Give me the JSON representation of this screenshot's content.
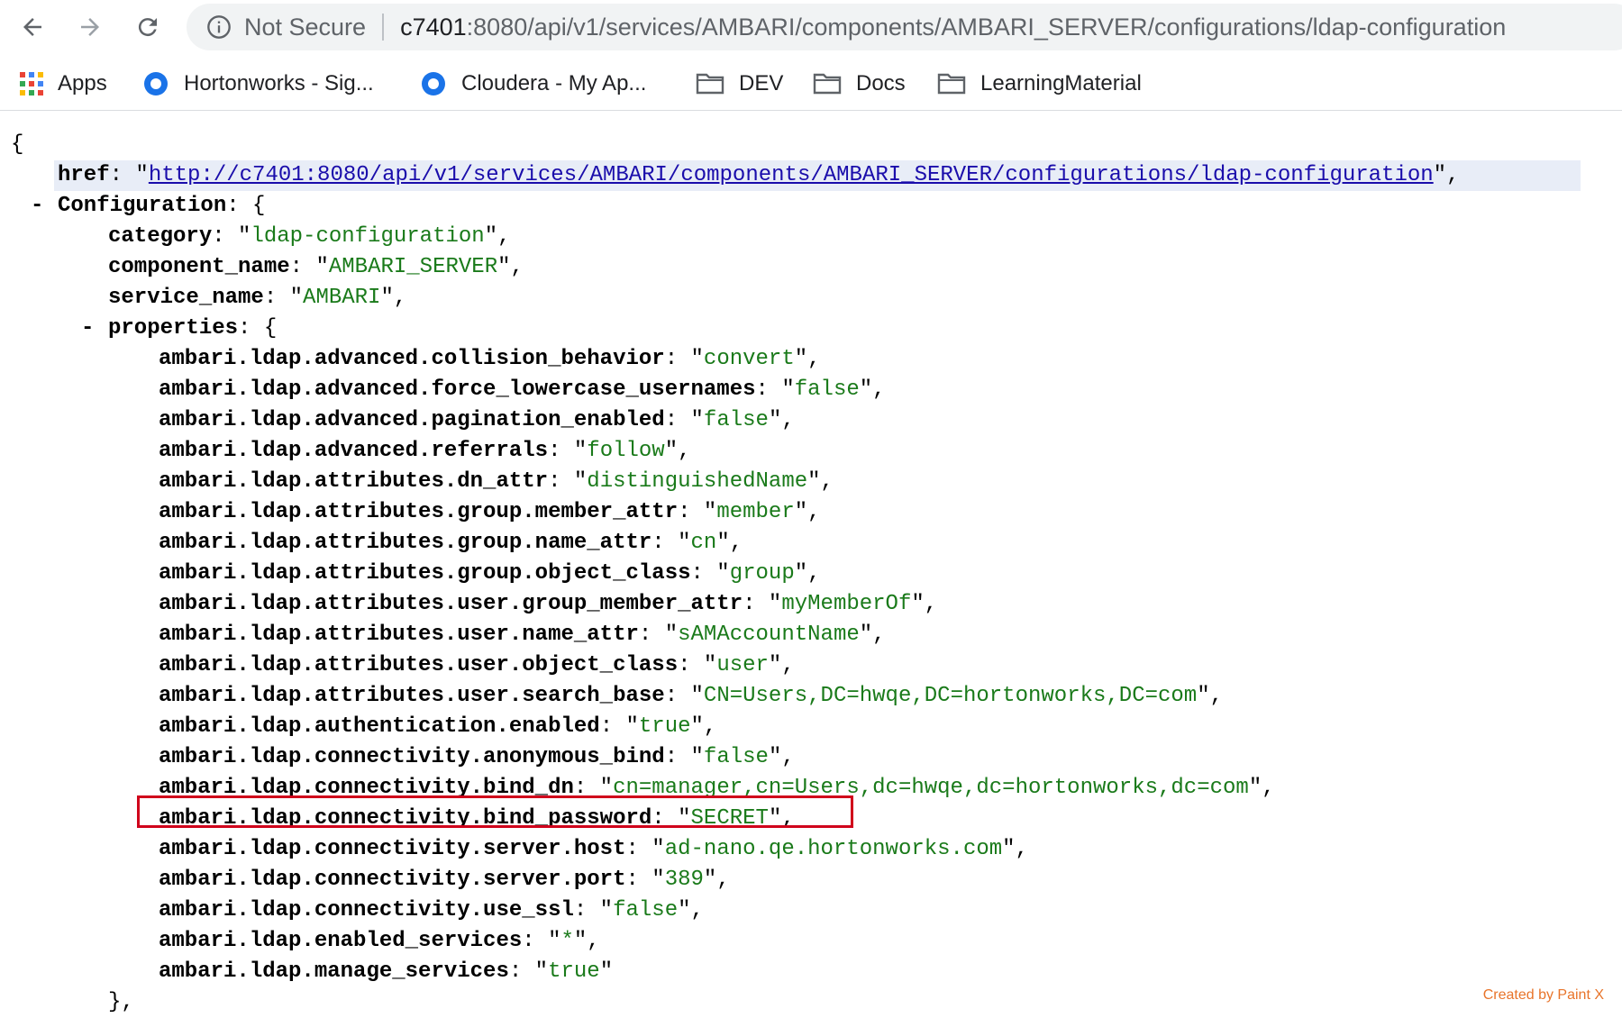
{
  "browser": {
    "security_label": "Not Secure",
    "url_host": "c7401",
    "url_rest": ":8080/api/v1/services/AMBARI/components/AMBARI_SERVER/configurations/ldap-configuration"
  },
  "bookmarks": [
    {
      "label": "Apps",
      "icon": "apps-grid-icon"
    },
    {
      "label": "Hortonworks - Sig...",
      "icon": "hortonworks-logo-icon"
    },
    {
      "label": "Cloudera - My Ap...",
      "icon": "cloudera-logo-icon"
    },
    {
      "label": "DEV",
      "icon": "folder-icon"
    },
    {
      "label": "Docs",
      "icon": "folder-icon"
    },
    {
      "label": "LearningMaterial",
      "icon": "folder-icon"
    }
  ],
  "json": {
    "open_brace": "{",
    "href_key": "href",
    "href_value": "http://c7401:8080/api/v1/services/AMBARI/components/AMBARI_SERVER/configurations/ldap-configuration",
    "configuration_key": "Configuration",
    "category_key": "category",
    "category_value": "ldap-configuration",
    "component_key": "component_name",
    "component_value": "AMBARI_SERVER",
    "service_key": "service_name",
    "service_value": "AMBARI",
    "properties_key": "properties",
    "properties": [
      {
        "key": "ambari.ldap.advanced.collision_behavior",
        "value": "convert"
      },
      {
        "key": "ambari.ldap.advanced.force_lowercase_usernames",
        "value": "false"
      },
      {
        "key": "ambari.ldap.advanced.pagination_enabled",
        "value": "false"
      },
      {
        "key": "ambari.ldap.advanced.referrals",
        "value": "follow"
      },
      {
        "key": "ambari.ldap.attributes.dn_attr",
        "value": "distinguishedName"
      },
      {
        "key": "ambari.ldap.attributes.group.member_attr",
        "value": "member"
      },
      {
        "key": "ambari.ldap.attributes.group.name_attr",
        "value": "cn"
      },
      {
        "key": "ambari.ldap.attributes.group.object_class",
        "value": "group"
      },
      {
        "key": "ambari.ldap.attributes.user.group_member_attr",
        "value": "myMemberOf"
      },
      {
        "key": "ambari.ldap.attributes.user.name_attr",
        "value": "sAMAccountName"
      },
      {
        "key": "ambari.ldap.attributes.user.object_class",
        "value": "user"
      },
      {
        "key": "ambari.ldap.attributes.user.search_base",
        "value": "CN=Users,DC=hwqe,DC=hortonworks,DC=com"
      },
      {
        "key": "ambari.ldap.authentication.enabled",
        "value": "true"
      },
      {
        "key": "ambari.ldap.connectivity.anonymous_bind",
        "value": "false"
      },
      {
        "key": "ambari.ldap.connectivity.bind_dn",
        "value": "cn=manager,cn=Users,dc=hwqe,dc=hortonworks,dc=com"
      },
      {
        "key": "ambari.ldap.connectivity.bind_password",
        "value": "SECRET"
      },
      {
        "key": "ambari.ldap.connectivity.server.host",
        "value": "ad-nano.qe.hortonworks.com"
      },
      {
        "key": "ambari.ldap.connectivity.server.port",
        "value": "389"
      },
      {
        "key": "ambari.ldap.connectivity.use_ssl",
        "value": "false"
      },
      {
        "key": "ambari.ldap.enabled_services",
        "value": "*"
      },
      {
        "key": "ambari.ldap.manage_services",
        "value": "true"
      }
    ],
    "closing": "},"
  },
  "watermark": "Created by Paint X",
  "colors": {
    "string": "#1a7a1a",
    "highlight_box": "#d0021b",
    "link": "#1a0dab"
  }
}
